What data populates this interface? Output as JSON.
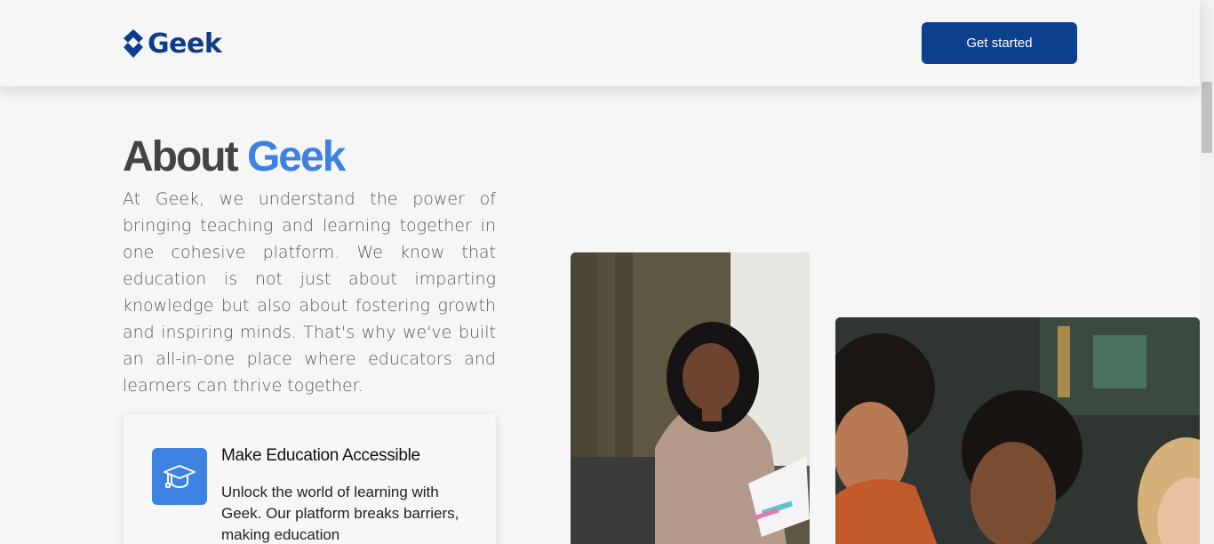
{
  "header": {
    "logo_text": "Geek",
    "cta_label": "Get started"
  },
  "about": {
    "title_prefix": "About",
    "title_accent": "Geek",
    "body": "At Geek, we understand the power of bringing teaching and learning together in one cohesive platform. We know that education is not just about imparting knowledge but also about fostering growth and inspiring minds. That's why we've built an all-in-one place where educators and learners can thrive together."
  },
  "feature_card": {
    "icon": "graduation-cap-icon",
    "title": "Make Education Accessible",
    "text": "Unlock the world of learning with Geek. Our platform breaks barriers, making education"
  },
  "photos": [
    {
      "name": "woman-with-papers-photo"
    },
    {
      "name": "group-of-students-photo"
    }
  ],
  "colors": {
    "brand_dark": "#0d3f8f",
    "accent": "#3d82e2",
    "background": "#f6f6f6"
  }
}
